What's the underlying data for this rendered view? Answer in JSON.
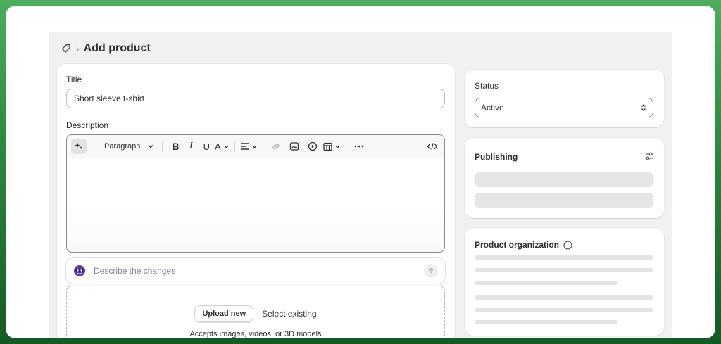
{
  "breadcrumb": {
    "page_title": "Add product",
    "separator": "›",
    "icon": "tag-icon"
  },
  "main": {
    "title_label": "Title",
    "title_value": "Short sleeve t-shirt",
    "description_label": "Description",
    "toolbar": {
      "paragraph_label": "Paragraph",
      "items": [
        "magic-icon",
        "bold-icon",
        "italic-icon",
        "underline-icon",
        "text-color-icon",
        "align-icon",
        "link-icon",
        "image-icon",
        "video-icon",
        "table-icon",
        "more-icon",
        "code-icon"
      ]
    },
    "ai_prompt": {
      "placeholder": "Describe the changes"
    },
    "media": {
      "upload_label": "Upload new",
      "select_label": "Select existing",
      "accepts_text": "Accepts images, videos, or 3D models"
    }
  },
  "status": {
    "title": "Status",
    "value": "Active"
  },
  "publishing": {
    "title": "Publishing"
  },
  "organization": {
    "title": "Product organization"
  },
  "colors": {
    "accent": "#303030",
    "border": "#8a8a8a",
    "skeleton": "#e6e6e6"
  }
}
